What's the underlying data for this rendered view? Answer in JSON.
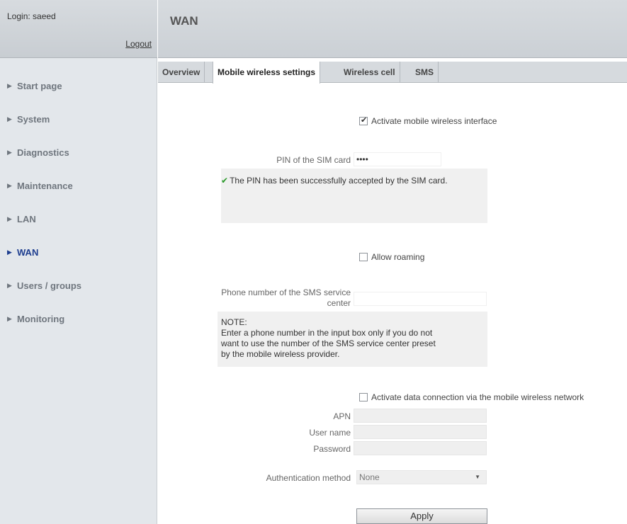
{
  "sidebar": {
    "login_text": "Login: saeed",
    "logout_label": "Logout",
    "items": [
      {
        "label": "Start page"
      },
      {
        "label": "System"
      },
      {
        "label": "Diagnostics"
      },
      {
        "label": "Maintenance"
      },
      {
        "label": "LAN"
      },
      {
        "label": "WAN"
      },
      {
        "label": "Users / groups"
      },
      {
        "label": "Monitoring"
      }
    ],
    "active_item": "WAN",
    "active_color": "#1e3e8f"
  },
  "header": {
    "title": "WAN"
  },
  "tabs": [
    {
      "label": "Overview"
    },
    {
      "label": "Mobile wireless settings"
    },
    {
      "label": "Wireless cell"
    },
    {
      "label": "SMS"
    }
  ],
  "active_tab": "Mobile wireless settings",
  "form": {
    "activate_interface_label": "Activate mobile wireless interface",
    "activate_interface_checked": true,
    "pin_label": "PIN of the SIM card",
    "pin_value": "••••",
    "pin_success_icon": "check-icon",
    "pin_success_text": "The PIN has been successfully accepted by the SIM card.",
    "success_color": "#2a9a2a",
    "allow_roaming_label": "Allow roaming",
    "allow_roaming_checked": false,
    "sms_center_label_line1": "Phone number of the SMS service",
    "sms_center_label_line2": "center",
    "sms_center_value": "",
    "note_title": "NOTE:",
    "note_line1": "Enter a phone number in the input box only if you do not",
    "note_line2": "want to use the number of the SMS service center preset",
    "note_line3": "by the mobile wireless provider.",
    "data_connection_label": "Activate data connection via the mobile wireless network",
    "data_connection_checked": false,
    "apn_label": "APN",
    "apn_value": "",
    "username_label": "User name",
    "username_value": "",
    "password_label": "Password",
    "password_value": "",
    "auth_method_label": "Authentication method",
    "auth_method_value": "None",
    "apply_label": "Apply"
  }
}
